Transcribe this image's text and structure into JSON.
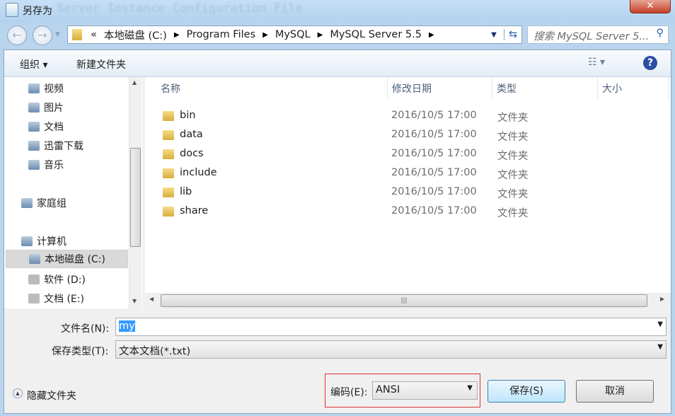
{
  "window": {
    "title": "另存为",
    "background_title": "Server Instance Configuration File"
  },
  "address": {
    "overflow": "«",
    "crumbs": [
      "本地磁盘 (C:)",
      "Program Files",
      "MySQL",
      "MySQL Server 5.5"
    ]
  },
  "search": {
    "placeholder": "搜索 MySQL Server 5..."
  },
  "toolbar": {
    "organize": "组织 ▾",
    "new_folder": "新建文件夹"
  },
  "nav": [
    {
      "label": "视频"
    },
    {
      "label": "图片"
    },
    {
      "label": "文档"
    },
    {
      "label": "迅雷下载"
    },
    {
      "label": "音乐"
    },
    {
      "label": "家庭组"
    },
    {
      "label": "计算机"
    },
    {
      "label": "本地磁盘 (C:)",
      "selected": true
    },
    {
      "label": "软件 (D:)"
    },
    {
      "label": "文档 (E:)"
    }
  ],
  "columns": {
    "name": "名称",
    "date": "修改日期",
    "type": "类型",
    "size": "大小"
  },
  "files": [
    {
      "name": "bin",
      "date": "2016/10/5 17:00",
      "type": "文件夹"
    },
    {
      "name": "data",
      "date": "2016/10/5 17:00",
      "type": "文件夹"
    },
    {
      "name": "docs",
      "date": "2016/10/5 17:00",
      "type": "文件夹"
    },
    {
      "name": "include",
      "date": "2016/10/5 17:00",
      "type": "文件夹"
    },
    {
      "name": "lib",
      "date": "2016/10/5 17:00",
      "type": "文件夹"
    },
    {
      "name": "share",
      "date": "2016/10/5 17:00",
      "type": "文件夹"
    }
  ],
  "form": {
    "filename_label": "文件名(N):",
    "filename": "my",
    "type_label": "保存类型(T):",
    "type": "文本文档(*.txt)",
    "encoding_label": "编码(E):",
    "encoding": "ANSI"
  },
  "buttons": {
    "hide": "隐藏文件夹",
    "save": "保存(S)",
    "cancel": "取消"
  }
}
